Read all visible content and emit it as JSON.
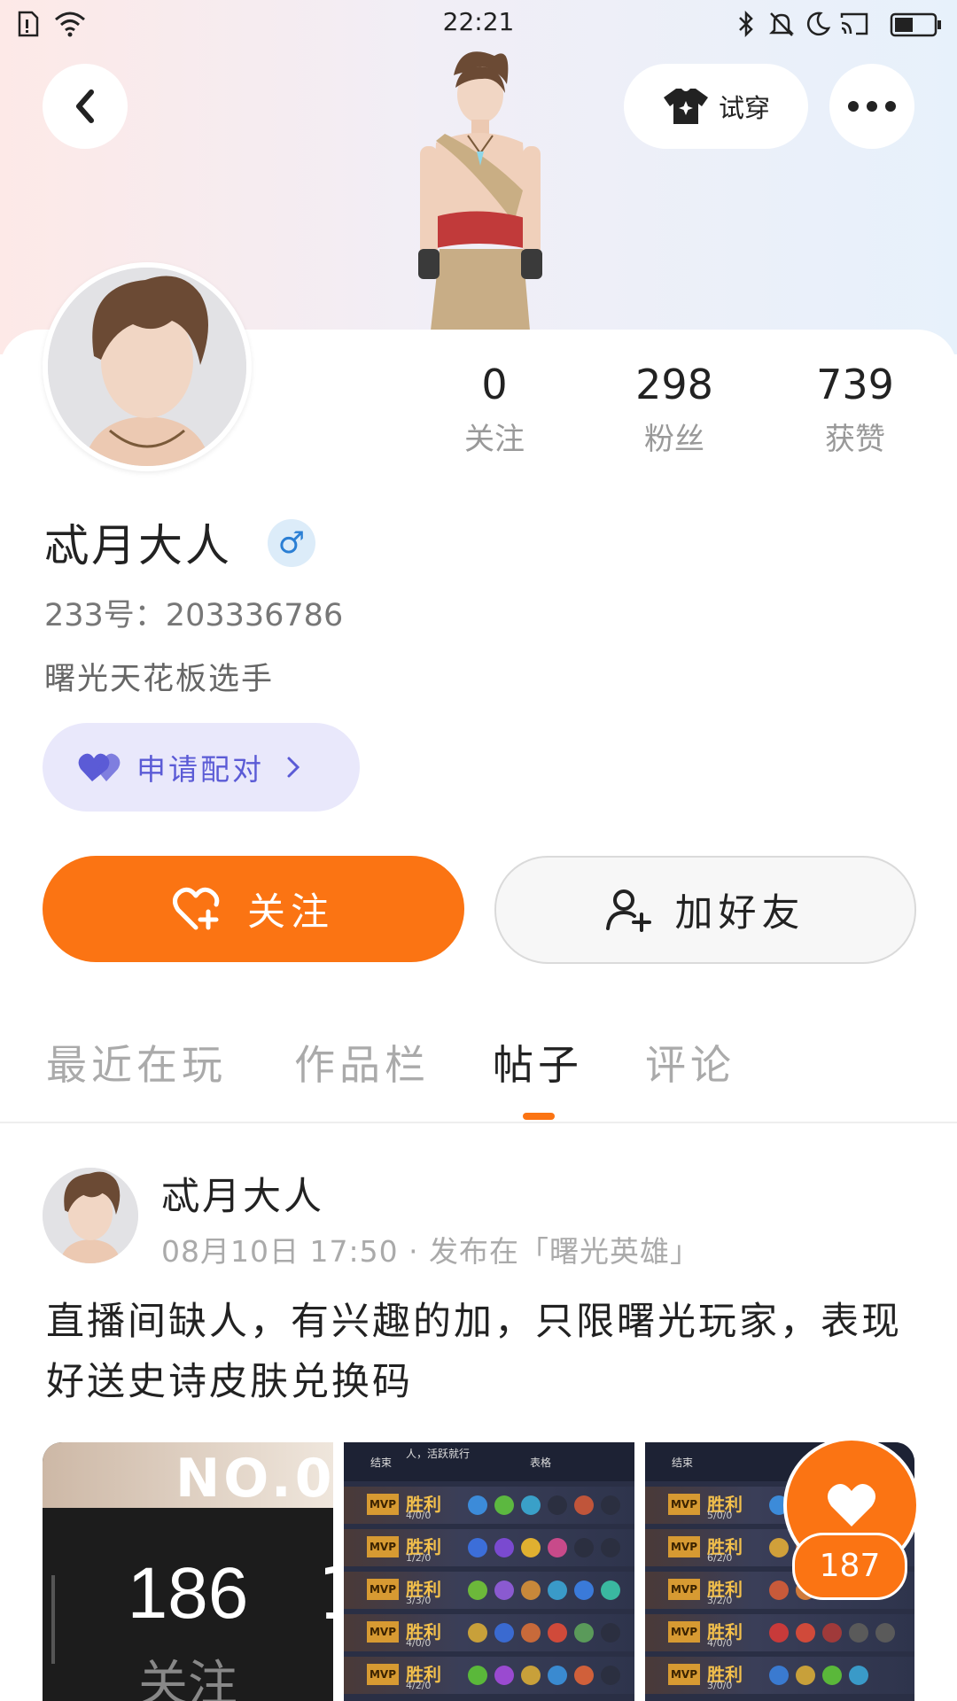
{
  "status_bar": {
    "time": "22:21"
  },
  "header": {
    "tryon_label": "试穿"
  },
  "profile": {
    "stats": [
      {
        "value": "0",
        "label": "关注"
      },
      {
        "value": "298",
        "label": "粉丝"
      },
      {
        "value": "739",
        "label": "获赞"
      }
    ],
    "username": "忒月大人",
    "gender_symbol": "♂",
    "user_id": "233号：203336786",
    "bio": "曙光天花板选手",
    "pair_label": "申请配对"
  },
  "actions": {
    "follow_label": "关注",
    "add_friend_label": "加好友"
  },
  "tabs": [
    {
      "label": "最近在玩"
    },
    {
      "label": "作品栏"
    },
    {
      "label": "帖子"
    },
    {
      "label": "评论"
    }
  ],
  "post": {
    "author": "忒月大人",
    "meta": "08月10日 17:50 · 发布在「曙光英雄」",
    "text": "直播间缺人，有兴趣的加，只限曙光玩家，表现好送史诗皮肤兑换码",
    "thumb1": {
      "number": "186",
      "caption": "关注",
      "banner": "NO.0"
    },
    "thumb2": {
      "header_left": "结束",
      "header_mid": "人，活跃就行",
      "header_right": "表格",
      "rows": [
        {
          "badge": "MVP",
          "result": "胜利",
          "kda": "4/0/0"
        },
        {
          "badge": "MVP",
          "result": "胜利",
          "kda": "1/2/0"
        },
        {
          "badge": "MVP",
          "result": "胜利",
          "kda": "3/3/0"
        },
        {
          "badge": "MVP",
          "result": "胜利",
          "kda": "4/0/0"
        },
        {
          "badge": "MVP",
          "result": "胜利",
          "kda": "4/2/0"
        }
      ]
    },
    "thumb3": {
      "header_left": "结束",
      "rows": [
        {
          "badge": "MVP",
          "result": "胜利",
          "kda": "5/0/0"
        },
        {
          "badge": "MVP",
          "result": "胜利",
          "kda": "6/2/0"
        },
        {
          "badge": "MVP",
          "result": "胜利",
          "kda": "3/2/0"
        },
        {
          "badge": "MVP",
          "result": "胜利",
          "kda": "4/0/0"
        },
        {
          "badge": "MVP",
          "result": "胜利",
          "kda": "3/0/0"
        }
      ]
    },
    "like_count": "187"
  },
  "colors": {
    "accent": "#fb7413",
    "pair_bg": "#e9e8fb",
    "pair_text": "#5b5bd6"
  }
}
